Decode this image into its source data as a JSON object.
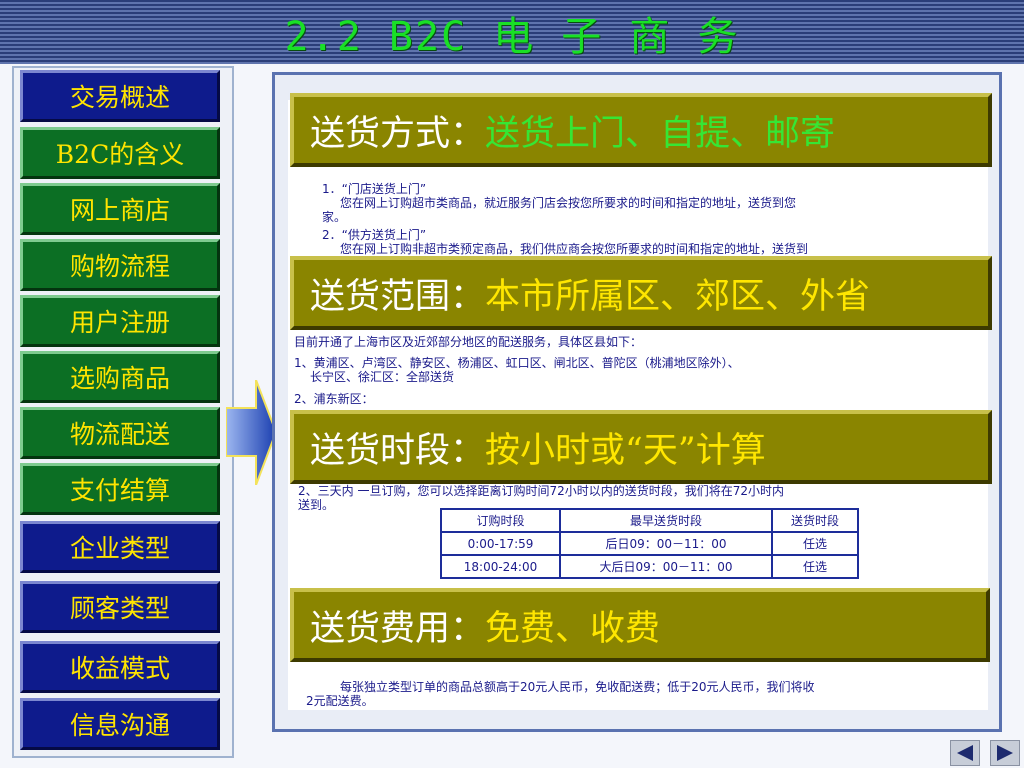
{
  "header": {
    "title": "2.2 B2C 电 子 商 务"
  },
  "sidebar": {
    "items": [
      {
        "label": "交易概述",
        "style": "blue"
      },
      {
        "label": "B2C的含义",
        "style": "green"
      },
      {
        "label": "网上商店",
        "style": "green"
      },
      {
        "label": "购物流程",
        "style": "green"
      },
      {
        "label": "用户注册",
        "style": "green"
      },
      {
        "label": "选购商品",
        "style": "green"
      },
      {
        "label": "物流配送",
        "style": "green"
      },
      {
        "label": "支付结算",
        "style": "green"
      },
      {
        "label": "企业类型",
        "style": "blue"
      },
      {
        "label": "顾客类型",
        "style": "blue"
      },
      {
        "label": "收益模式",
        "style": "blue"
      },
      {
        "label": "信息沟通",
        "style": "blue"
      }
    ]
  },
  "banners": [
    {
      "label": "送货方式：",
      "value": "送货上门、自提、邮寄"
    },
    {
      "label": "送货范围：",
      "value": "本市所属区、郊区、外省"
    },
    {
      "label": "送货时段：",
      "value": "按小时或“天”计算"
    },
    {
      "label": "送货费用：",
      "value": "免费、收费"
    }
  ],
  "doc": {
    "methods": [
      "1．“门店送货上门”",
      "您在网上订购超市类商品，就近服务门店会按您所要求的时间和指定的地址，送货到您",
      "家。",
      "2．“供方送货上门”",
      "您在网上订购非超市类预定商品，我们供应商会按您所要求的时间和指定的地址，送货到"
    ],
    "scope": [
      "目前开通了上海市区及近郊部分地区的配送服务，具体区县如下：",
      "1、黄浦区、卢湾区、静安区、杨浦区、虹口区、闸北区、普陀区（桃浦地区除外）、",
      "长宁区、徐汇区：全部送货",
      "2、浦东新区："
    ],
    "time_note": "2、三天内  一旦订购，您可以选择距离订购时间72小时以内的送货时段，我们将在72小时内",
    "time_note2": "送到。",
    "table": {
      "headers": [
        "订购时段",
        "最早送货时段",
        "送货时段"
      ],
      "rows": [
        [
          "0:00-17:59",
          "后日09：00－11：00",
          "任选"
        ],
        [
          "18:00-24:00",
          "大后日09：00－11：00",
          "任选"
        ]
      ]
    },
    "fee": [
      "每张独立类型订单的商品总额高于20元人民币，免收配送费；低于20元人民币，我们将收",
      "2元配送费。"
    ]
  },
  "colors": {
    "nav_text": "#ffe400",
    "banner_bg": "#8a8500",
    "title": "#19e026"
  },
  "controls": {
    "prev_icon": "prev-triangle-icon",
    "next_icon": "next-triangle-icon"
  }
}
